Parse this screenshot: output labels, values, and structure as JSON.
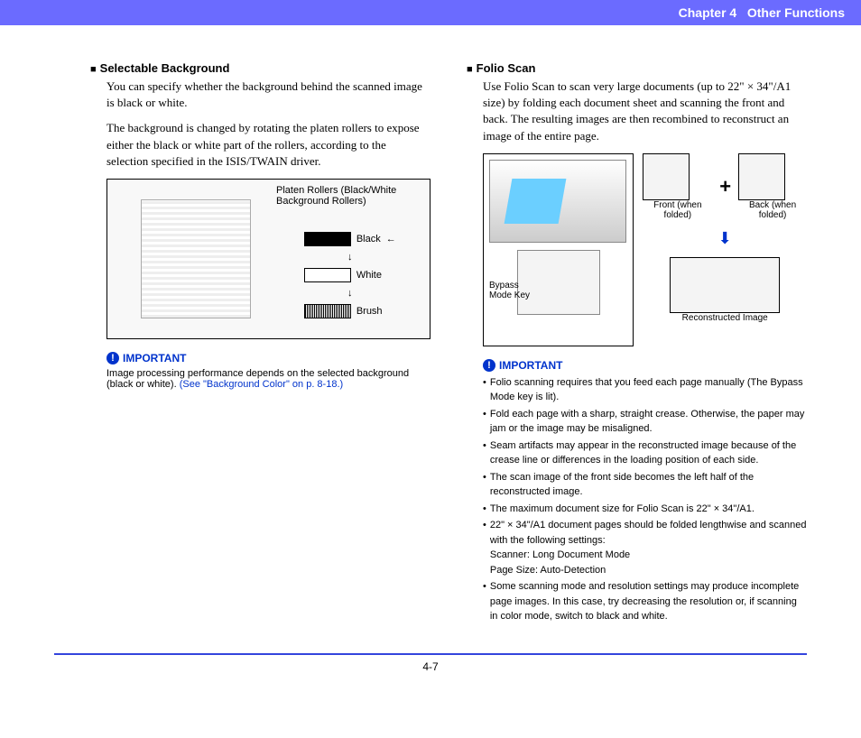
{
  "header": {
    "chapter": "Chapter 4",
    "title": "Other Functions"
  },
  "left": {
    "heading": "Selectable Background",
    "para1": "You can specify whether the background behind the scanned image is black or white.",
    "para2": "The background is changed by rotating the platen rollers to expose either the black or white part of the rollers, according to the selection specified in the ISIS/TWAIN driver.",
    "diagram": {
      "caption": "Platen Rollers (Black/White Background Rollers)",
      "labels": {
        "black": "Black",
        "white": "White",
        "brush": "Brush"
      }
    },
    "important": {
      "label": "IMPORTANT",
      "text": "Image processing performance depends on the selected background (black or white). ",
      "link": "(See \"Background Color\" on p. 8-18.)"
    }
  },
  "right": {
    "heading": "Folio Scan",
    "para1": "Use Folio Scan to scan very large documents (up to 22\" × 34\"/A1 size) by folding each document sheet and scanning the front and back. The resulting images are then recombined to reconstruct an image of the entire page.",
    "diagram": {
      "bypass": "Bypass Mode Key",
      "front": "Front (when folded)",
      "back": "Back (when folded)",
      "recon": "Reconstructed Image",
      "plus": "+"
    },
    "important": {
      "label": "IMPORTANT",
      "bullets": [
        "Folio scanning requires that you feed each page manually (The Bypass Mode key is lit).",
        "Fold each page with a sharp, straight crease. Otherwise, the paper may jam or the image may be misaligned.",
        "Seam artifacts may appear in the reconstructed image because of the crease line or differences in the loading position of each side.",
        "The scan image of the front side becomes the left half of the reconstructed image.",
        "The maximum document size for Folio Scan is 22\" × 34\"/A1.",
        "22\" × 34\"/A1 document pages should be folded lengthwise and scanned with the following settings:\nScanner: Long Document Mode\nPage Size: Auto-Detection",
        "Some scanning mode and resolution settings may produce incomplete page images. In this case, try decreasing the resolution or, if scanning in color mode, switch to black and white."
      ]
    }
  },
  "footer": {
    "page": "4-7"
  }
}
